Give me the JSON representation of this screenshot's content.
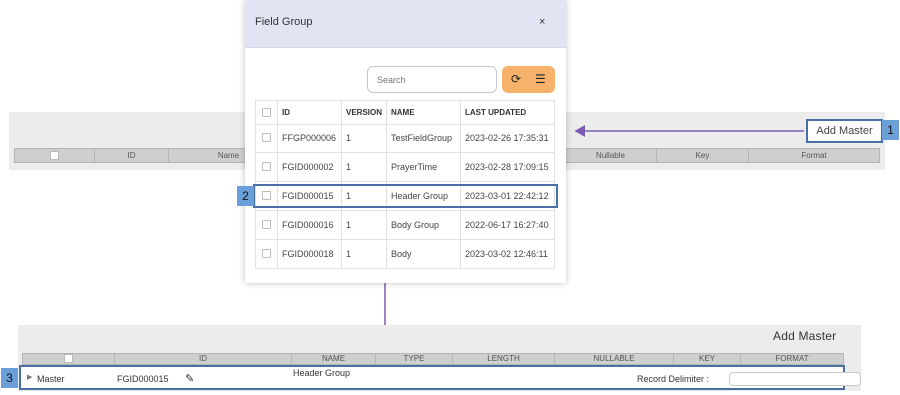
{
  "background_grid": {
    "columns": [
      "",
      "ID",
      "Name",
      "Nullable",
      "Key",
      "Format"
    ]
  },
  "add_master_button": {
    "label": "Add Master"
  },
  "callouts": [
    "1",
    "2",
    "3"
  ],
  "modal": {
    "title": "Field Group",
    "close_label": "×",
    "search_placeholder": "Search",
    "refresh_icon": "refresh-icon",
    "list_icon": "list-icon",
    "columns": [
      "ID",
      "VERSION",
      "NAME",
      "LAST UPDATED"
    ],
    "rows": [
      {
        "id": "FFGP000006",
        "version": "1",
        "name": "TestFieldGroup",
        "updated": "2023-02-26 17:35:31"
      },
      {
        "id": "FGID000002",
        "version": "1",
        "name": "PrayerTime",
        "updated": "2023-02-28 17:09:15"
      },
      {
        "id": "FGID000015",
        "version": "1",
        "name": "Header Group",
        "updated": "2023-03-01 22:42:12"
      },
      {
        "id": "FGID000016",
        "version": "1",
        "name": "Body Group",
        "updated": "2022-06-17 16:27:40"
      },
      {
        "id": "FGID000018",
        "version": "1",
        "name": "Body",
        "updated": "2023-03-02 12:46:11"
      }
    ]
  },
  "bottom_panel": {
    "title": "Add Master",
    "columns": [
      "",
      "ID",
      "NAME",
      "TYPE",
      "LENGTH",
      "NULLABLE",
      "KEY",
      "FORMAT"
    ],
    "master_row": {
      "label": "Master",
      "id": "FGID000015",
      "name": "Header Group",
      "record_delimiter_label": "Record Delimiter :",
      "record_delimiter_value": ""
    }
  },
  "colors": {
    "accent": "#4a6fa5",
    "arrow": "#7b5cb0",
    "callout": "#6b9fd8",
    "button_orange": "#f6b26b",
    "modal_header": "#e3e4f3"
  }
}
